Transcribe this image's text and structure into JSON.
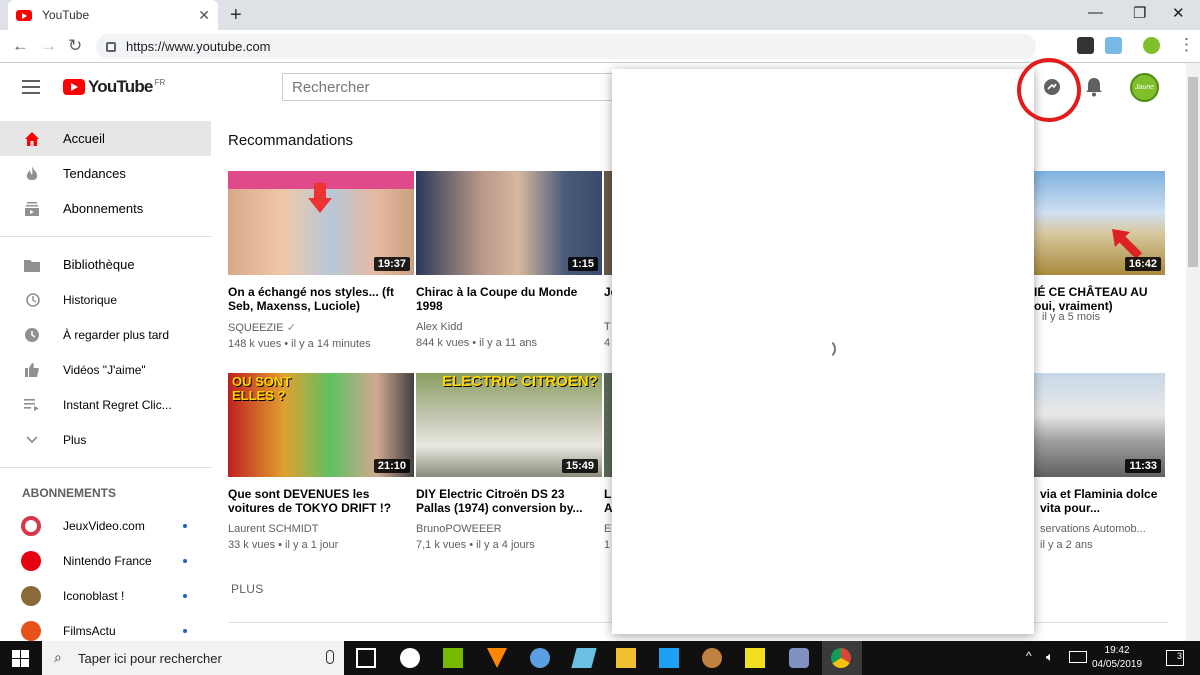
{
  "browser": {
    "tab_title": "YouTube",
    "url": "https://www.youtube.com"
  },
  "youtube": {
    "logo_text": "YouTube",
    "logo_region": "FR",
    "search_placeholder": "Rechercher",
    "avatar_text": "Jaune",
    "sidebar": {
      "main": [
        {
          "label": "Accueil",
          "icon": "home-icon"
        },
        {
          "label": "Tendances",
          "icon": "flame-icon"
        },
        {
          "label": "Abonnements",
          "icon": "subscriptions-icon"
        }
      ],
      "library": [
        {
          "label": "Bibliothèque",
          "icon": "folder-icon"
        },
        {
          "label": "Historique",
          "icon": "history-icon"
        },
        {
          "label": "À regarder plus tard",
          "icon": "clock-icon"
        },
        {
          "label": "Vidéos \"J'aime\"",
          "icon": "thumbs-up-icon"
        },
        {
          "label": "Instant Regret Clic...",
          "icon": "playlist-icon"
        },
        {
          "label": "Plus",
          "icon": "chevron-down-icon"
        }
      ],
      "subscriptions_heading": "ABONNEMENTS",
      "subscriptions": [
        {
          "label": "JeuxVideo.com"
        },
        {
          "label": "Nintendo France"
        },
        {
          "label": "Iconoblast !"
        },
        {
          "label": "FilmsActu"
        }
      ]
    },
    "section_title": "Recommandations",
    "videos": [
      {
        "title": "On a échangé nos styles... (ft Seb, Maxenss, Luciole)",
        "channel": "SQUEEZIE",
        "meta": "148 k vues • il y a 14 minutes",
        "duration": "19:37"
      },
      {
        "title": "Chirac à la Coupe du Monde 1998",
        "channel": "Alex Kidd",
        "meta": "844 k vues • il y a 11 ans",
        "duration": "1:15"
      },
      {
        "title": "Je",
        "channel": "T",
        "meta": "4",
        "duration": ""
      },
      {
        "title": "IÉ CE CHÂTEAU AU oui, vraiment)",
        "channel": "",
        "meta": "il y a 5 mois",
        "duration": "16:42"
      },
      {
        "title": "Que sont DEVENUES les voitures de TOKYO DRIFT !?",
        "channel": "Laurent SCHMIDT",
        "meta": "33 k vues • il y a 1 jour",
        "duration": "21:10"
      },
      {
        "title": "DIY Electric Citroën DS 23 Pallas (1974) conversion by...",
        "channel": "BrunoPOWEEER",
        "meta": "7,1 k vues • il y a 4 jours",
        "duration": "15:49"
      },
      {
        "title": "L' A",
        "channel": "E",
        "meta": "1",
        "duration": ""
      },
      {
        "title": "via et Flaminia dolce vita pour...",
        "channel": "servations Automob...",
        "meta": "il y a 2 ans",
        "duration": "11:33"
      }
    ],
    "thumb_texts": {
      "tokyo": "OU SONT ELLES ?",
      "citroen": "ELECTRIC CITROEN?"
    },
    "plus_label": "PLUS"
  },
  "taskbar": {
    "search_placeholder": "Taper ici pour rechercher",
    "time": "19:42",
    "date": "04/05/2019",
    "notifications": "3"
  },
  "colors": {
    "yt_red": "#ff0000",
    "annotation_red": "#e41b1b"
  }
}
